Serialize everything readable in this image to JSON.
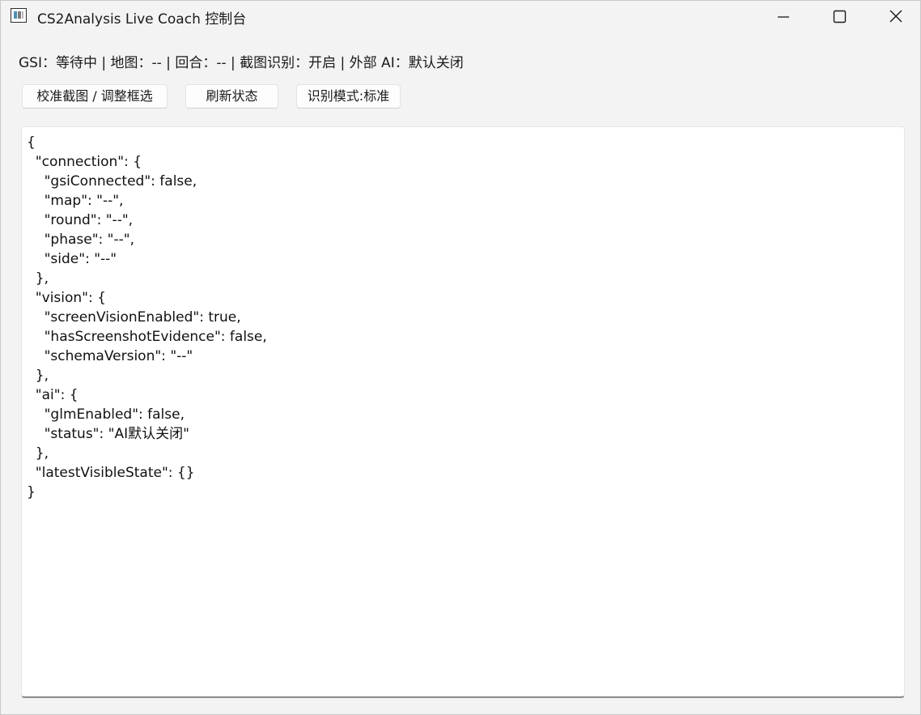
{
  "window": {
    "title": "CS2Analysis Live Coach 控制台",
    "app_icon": "app-window-icon",
    "controls": {
      "minimize_icon": "minimize-icon",
      "maximize_icon": "maximize-icon",
      "close_icon": "close-icon"
    }
  },
  "status": {
    "text": "GSI：等待中  |  地图：--  |  回合：--  |  截图识别：开启  |  外部 AI：默认关闭"
  },
  "toolbar": {
    "calibrate_label": "校准截图 / 调整框选",
    "refresh_label": "刷新状态",
    "mode_label": "识别模式:标准"
  },
  "output": {
    "json_text": "{\n  \"connection\": {\n    \"gsiConnected\": false,\n    \"map\": \"--\",\n    \"round\": \"--\",\n    \"phase\": \"--\",\n    \"side\": \"--\"\n  },\n  \"vision\": {\n    \"screenVisionEnabled\": true,\n    \"hasScreenshotEvidence\": false,\n    \"schemaVersion\": \"--\"\n  },\n  \"ai\": {\n    \"glmEnabled\": false,\n    \"status\": \"AI默认关闭\"\n  },\n  \"latestVisibleState\": {}\n}"
  },
  "colors": {
    "window_bg": "#f3f3f3",
    "panel_bg": "#ffffff",
    "text": "#1a1a1a"
  }
}
